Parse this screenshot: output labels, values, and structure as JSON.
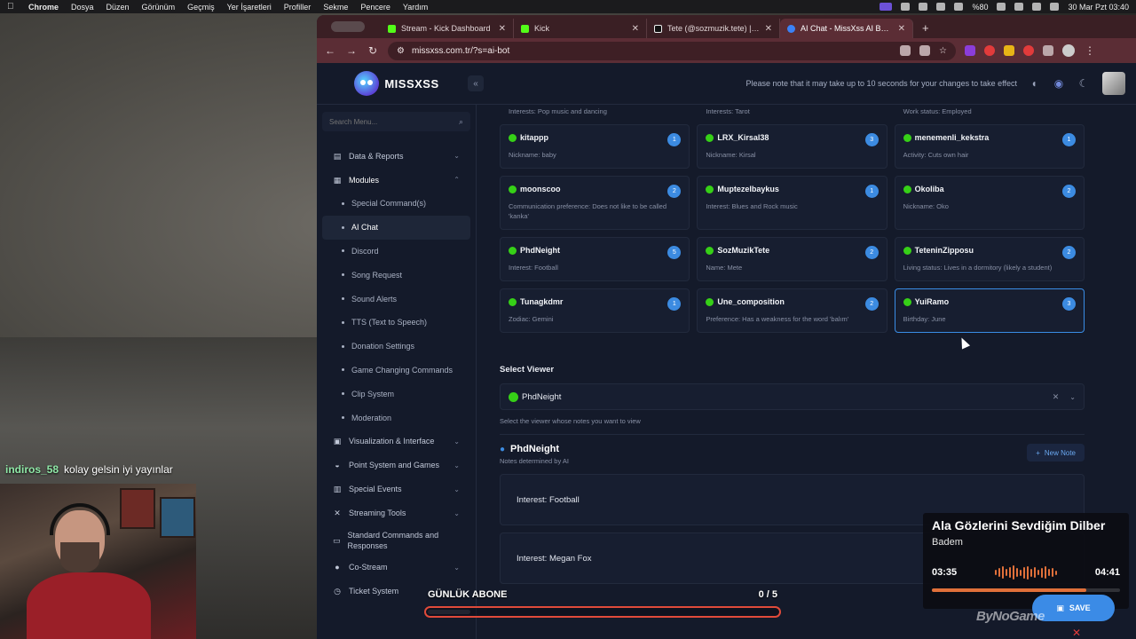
{
  "menubar": {
    "app": "Chrome",
    "items": [
      "Dosya",
      "Düzen",
      "Görünüm",
      "Geçmiş",
      "Yer İşaretleri",
      "Profiller",
      "Sekme",
      "Pencere",
      "Yardım"
    ],
    "battery": "%80",
    "datetime": "30 Mar Pzt  03:40"
  },
  "browser": {
    "tabs": [
      {
        "title": "Stream - Kick Dashboard",
        "icon": "kick-icon"
      },
      {
        "title": "Kick",
        "icon": "kick-icon"
      },
      {
        "title": "Tete (@sozmuzik.tete) | TikTo",
        "icon": "tiktok-icon"
      },
      {
        "title": "AI Chat - MissXss AI Bot Syst",
        "icon": "ai-icon"
      }
    ],
    "url": "missxss.com.tr/?s=ai-bot"
  },
  "app": {
    "logo_text": "MISSXSS",
    "notice": "Please note that it may take up to 10 seconds for your changes to take effect"
  },
  "sidebar": {
    "search_placeholder": "Search Menu...",
    "items": [
      {
        "label": "Data & Reports",
        "icon": "document-icon"
      },
      {
        "label": "Modules",
        "icon": "grid-icon"
      },
      {
        "label": "Visualization & Interface",
        "icon": "briefcase-icon"
      },
      {
        "label": "Point System and Games",
        "icon": "coins-icon"
      },
      {
        "label": "Special Events",
        "icon": "calendar-icon"
      },
      {
        "label": "Streaming Tools",
        "icon": "tools-icon"
      },
      {
        "label": "Standard Commands and Responses",
        "icon": "keyboard-icon"
      },
      {
        "label": "Co-Stream",
        "icon": "users-icon"
      },
      {
        "label": "Ticket System",
        "icon": "ticket-icon"
      }
    ],
    "module_sub": [
      "Special Command(s)",
      "AI Chat",
      "Discord",
      "Song Request",
      "Sound Alerts",
      "TTS (Text to Speech)",
      "Donation Settings",
      "Game Changing Commands",
      "Clip System",
      "Moderation"
    ]
  },
  "viewers": {
    "partial_notes": [
      "Interests: Pop music and dancing",
      "Interests: Tarot",
      "Work status: Employed"
    ],
    "cards": [
      {
        "name": "kitappp",
        "note": "Nickname: baby",
        "count": "1"
      },
      {
        "name": "LRX_Kirsal38",
        "note": "Nickname: Kirsal",
        "count": "3"
      },
      {
        "name": "menemenli_kekstra",
        "note": "Activity: Cuts own hair",
        "count": "1"
      },
      {
        "name": "moonscoo",
        "note": "Communication preference: Does not like to be called 'kanka'",
        "count": "2"
      },
      {
        "name": "Muptezelbaykus",
        "note": "Interest: Blues and Rock music",
        "count": "1"
      },
      {
        "name": "Okoliba",
        "note": "Nickname: Oko",
        "count": "2"
      },
      {
        "name": "PhdNeight",
        "note": "Interest: Football",
        "count": "5"
      },
      {
        "name": "SozMuzikTete",
        "note": "Name: Mete",
        "count": "2"
      },
      {
        "name": "TeteninZipposu",
        "note": "Living status: Lives in a dormitory (likely a student)",
        "count": "2"
      },
      {
        "name": "Tunagkdmr",
        "note": "Zodiac: Gemini",
        "count": "1"
      },
      {
        "name": "Une_composition",
        "note": "Preference: Has a weakness for the word 'balım'",
        "count": "2"
      },
      {
        "name": "YuiRamo",
        "note": "Birthday: June",
        "count": "3"
      }
    ]
  },
  "select_viewer": {
    "label": "Select Viewer",
    "value": "PhdNeight",
    "helper": "Select the viewer whose notes you want to view"
  },
  "notes": {
    "title": "PhdNeight",
    "subtitle": "Notes determined by AI",
    "new_note": "New Note",
    "items": [
      "Interest: Football",
      "Interest: Megan Fox"
    ]
  },
  "overlay": {
    "chat_user": "indiros_58",
    "chat_msg": "kolay gelsin iyi yayınlar",
    "goal_title": "GÜNLÜK ABONE",
    "goal_count": "0 / 5",
    "goal_progress": 0,
    "song_title": "Ala Gözlerini Sevdiğim Dilber",
    "song_artist": "Badem",
    "time_elapsed": "03:35",
    "time_total": "04:41",
    "song_progress": 0.82,
    "save": "SAVE",
    "watermark": "ByNoGame"
  }
}
